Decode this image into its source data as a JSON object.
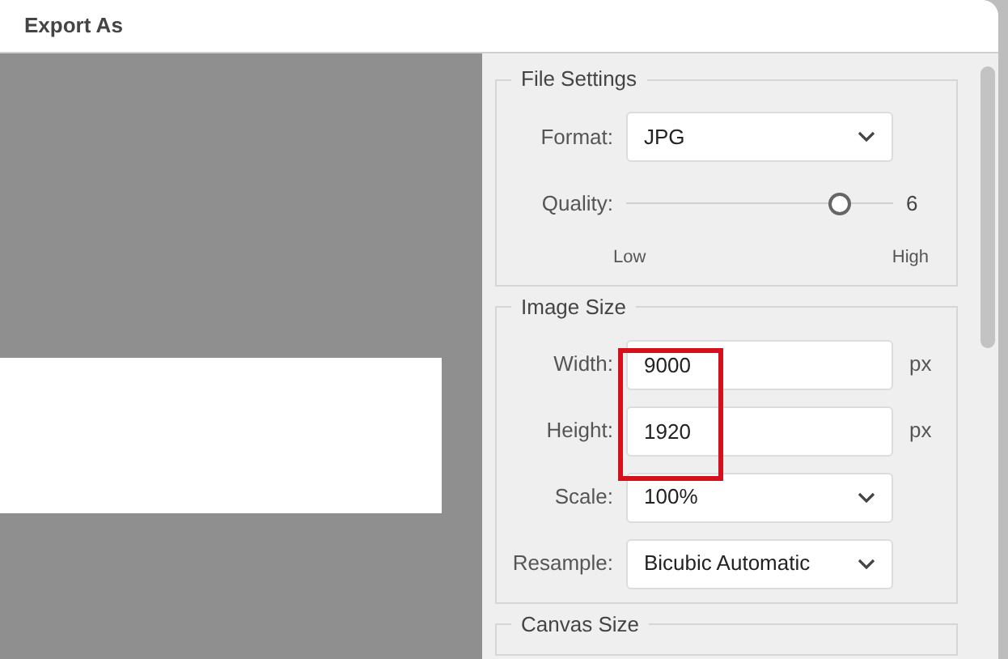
{
  "window": {
    "title": "Export As"
  },
  "file_settings": {
    "title": "File Settings",
    "format": {
      "label": "Format:",
      "value": "JPG"
    },
    "quality": {
      "label": "Quality:",
      "level": 0.8,
      "reading": "6",
      "min_label": "Low",
      "max_label": "High"
    }
  },
  "image_size": {
    "title": "Image Size",
    "fields": [
      {
        "kind": "input",
        "label": "Width:",
        "value": "9000",
        "unit": "px",
        "highlighted": true
      },
      {
        "kind": "input",
        "label": "Height:",
        "value": "1920",
        "unit": "px",
        "highlighted": true
      },
      {
        "kind": "select",
        "label": "Scale:",
        "value": "100%"
      },
      {
        "kind": "select",
        "label": "Resample:",
        "value": "Bicubic Automatic"
      }
    ]
  },
  "canvas_size": {
    "title": "Canvas Size"
  }
}
